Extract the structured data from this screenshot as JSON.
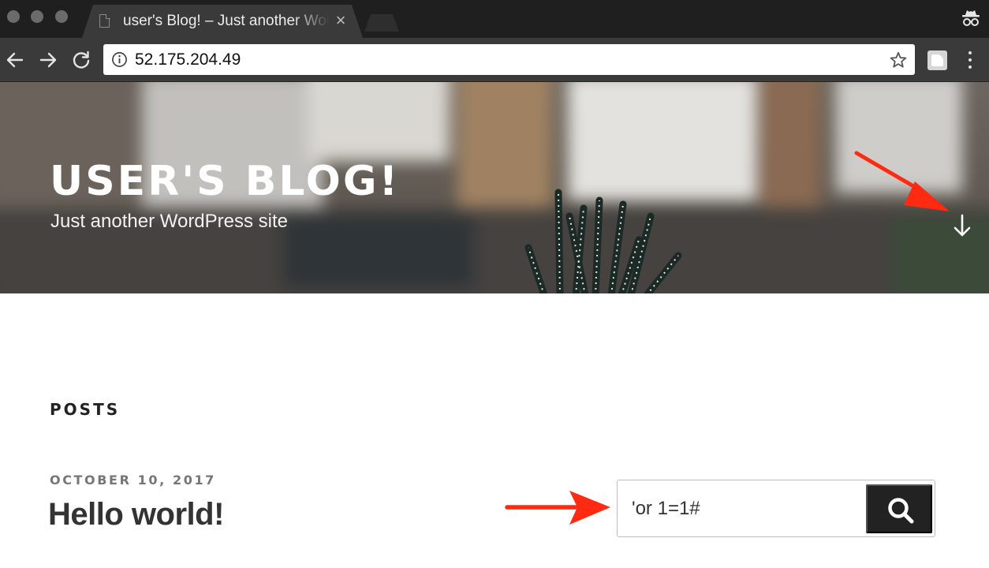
{
  "browser": {
    "tab_title": "user's Blog! – Just another WordPress site",
    "tab_close": "×",
    "url": "52.175.204.49",
    "icons": {
      "back": "arrow-left-icon",
      "forward": "arrow-right-icon",
      "reload": "reload-icon",
      "site_info": "info-icon",
      "bookmark": "star-icon",
      "extension": "extension-icon",
      "menu": "more-vert-icon",
      "incognito": "incognito-icon"
    }
  },
  "site": {
    "title": "user's Blog!",
    "description": "Just another WordPress site",
    "scroll_down_icon": "arrow-down-icon"
  },
  "main": {
    "section_heading": "POSTS",
    "posts": [
      {
        "date": "OCTOBER 10, 2017",
        "title": "Hello world!"
      }
    ]
  },
  "search": {
    "value": "'or 1=1#",
    "submit_icon": "search-icon"
  },
  "colors": {
    "annotation_arrow": "#ff2a12",
    "search_button": "#222222",
    "chrome_dark": "#1f1f1f",
    "toolbar": "#3a3a3a"
  }
}
